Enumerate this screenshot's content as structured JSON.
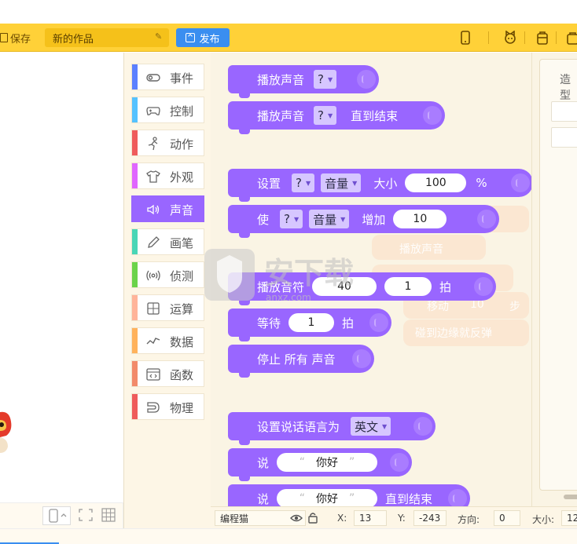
{
  "toolbar": {
    "save_label": "保存",
    "project_title": "新的作品",
    "publish_label": "发布",
    "right_icons": [
      "phone-icon",
      "cat-icon",
      "backpack-icon",
      "bag-icon"
    ]
  },
  "categories": [
    {
      "label": "事件",
      "color": "#5b80ff",
      "icon": "toggle-icon"
    },
    {
      "label": "控制",
      "color": "#55c2ff",
      "icon": "gamepad-icon"
    },
    {
      "label": "动作",
      "color": "#ef5b5b",
      "icon": "running-icon"
    },
    {
      "label": "外观",
      "color": "#e066ff",
      "icon": "shirt-icon"
    },
    {
      "label": "声音",
      "color": "#9966ff",
      "icon": "speaker-icon",
      "active": true
    },
    {
      "label": "画笔",
      "color": "#49d6b6",
      "icon": "pencil-icon"
    },
    {
      "label": "侦测",
      "color": "#6bd34a",
      "icon": "radar-icon"
    },
    {
      "label": "运算",
      "color": "#ffb49a",
      "icon": "calculator-icon"
    },
    {
      "label": "数据",
      "color": "#ffb25c",
      "icon": "chart-icon"
    },
    {
      "label": "函数",
      "color": "#f28a6a",
      "icon": "function-icon"
    },
    {
      "label": "物理",
      "color": "#ef5b5b",
      "icon": "magnet-icon"
    }
  ],
  "blocks": {
    "play_sound": {
      "label": "播放声音",
      "value": "?"
    },
    "play_sound_until": {
      "label": "播放声音",
      "value": "?",
      "suffix": "直到结束"
    },
    "set_effect": {
      "label": "设置",
      "value": "?",
      "effect": "音量",
      "middle": "大小",
      "amount": "100",
      "unit": "%"
    },
    "change_effect": {
      "label": "使",
      "value": "?",
      "effect": "音量",
      "middle": "增加",
      "amount": "10"
    },
    "play_note": {
      "label": "播放音符",
      "note": "40",
      "beats": "1",
      "unit": "拍"
    },
    "wait": {
      "label": "等待",
      "amount": "1",
      "unit": "拍"
    },
    "stop_all": {
      "label": "停止 所有 声音"
    },
    "set_lang": {
      "label": "设置说话语言为",
      "value": "英文"
    },
    "say": {
      "label": "说",
      "text": "你好"
    },
    "say_until": {
      "label": "说",
      "text": "你好",
      "suffix": "直到结束"
    }
  },
  "faint_text": {
    "line1": "播放声音",
    "line2": "移动",
    "line2_val": "10",
    "line2_unit": "步",
    "line3": "碰到边缘就反弹"
  },
  "right_panel": {
    "title": "造型"
  },
  "status_bar": {
    "sprite_name": "编程猫",
    "x_label": "X:",
    "x_value": "13",
    "y_label": "Y:",
    "y_value": "-243",
    "dir_label": "方向:",
    "dir_value": "0",
    "size_label": "大小:",
    "size_value": "12"
  }
}
